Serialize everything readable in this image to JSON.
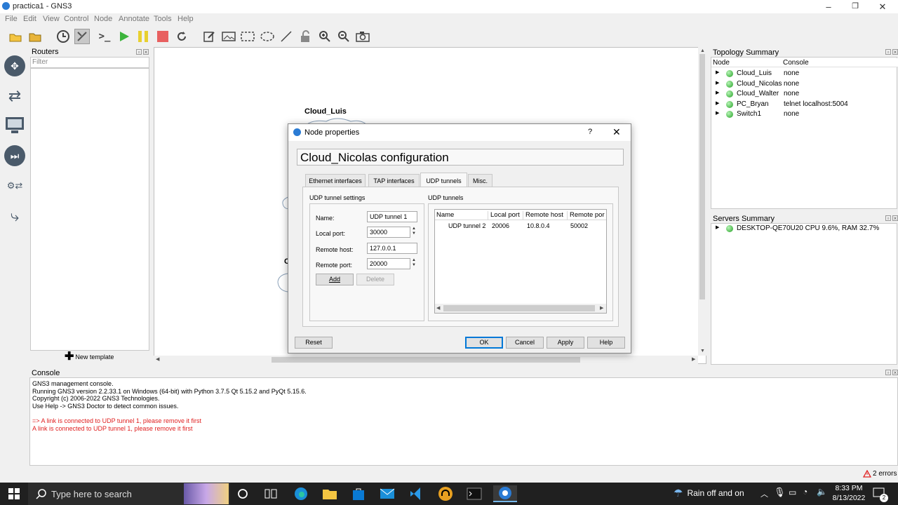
{
  "window": {
    "title": "practica1 - GNS3"
  },
  "menu": [
    "File",
    "Edit",
    "View",
    "Control",
    "Node",
    "Annotate",
    "Tools",
    "Help"
  ],
  "routers_panel": {
    "title": "Routers",
    "filter_placeholder": "Filter",
    "new_template": "New template"
  },
  "canvas": {
    "node_label": "Cloud_Luis",
    "partial_label": "C"
  },
  "topology": {
    "title": "Topology Summary",
    "col_node": "Node",
    "col_console": "Console",
    "rows": [
      {
        "node": "Cloud_Luis",
        "console": "none"
      },
      {
        "node": "Cloud_Nicolas",
        "console": "none"
      },
      {
        "node": "Cloud_Walter",
        "console": "none"
      },
      {
        "node": "PC_Bryan",
        "console": "telnet localhost:5004"
      },
      {
        "node": "Switch1",
        "console": "none"
      }
    ]
  },
  "servers": {
    "title": "Servers Summary",
    "row": "DESKTOP-QE70U20 CPU 9.6%, RAM 32.7%"
  },
  "console": {
    "title": "Console",
    "lines": [
      "GNS3 management console.",
      "Running GNS3 version 2.2.33.1 on Windows (64-bit) with Python 3.7.5 Qt 5.15.2 and PyQt 5.15.6.",
      "Copyright (c) 2006-2022 GNS3 Technologies.",
      "Use Help -> GNS3 Doctor to detect common issues."
    ],
    "errors": [
      "=> A link is connected to UDP tunnel 1, please remove it first",
      "A link is connected to UDP tunnel 1, please remove it first"
    ]
  },
  "status": {
    "errors": "2 errors"
  },
  "dialog": {
    "title": "Node properties",
    "help_char": "?",
    "header": "Cloud_Nicolas configuration",
    "tabs": [
      "Ethernet interfaces",
      "TAP interfaces",
      "UDP tunnels",
      "Misc."
    ],
    "settings_title": "UDP tunnel settings",
    "tunnels_title": "UDP tunnels",
    "name_label": "Name:",
    "name_value": "UDP tunnel 1",
    "local_port_label": "Local port:",
    "local_port_value": "30000",
    "remote_host_label": "Remote host:",
    "remote_host_value": "127.0.0.1",
    "remote_port_label": "Remote port:",
    "remote_port_value": "20000",
    "add": "Add",
    "delete": "Delete",
    "table_headers": [
      "Name",
      "Local port",
      "Remote host",
      "Remote por"
    ],
    "table_row": [
      "UDP tunnel 2",
      "20006",
      "10.8.0.4",
      "50002"
    ],
    "reset": "Reset",
    "ok": "OK",
    "cancel": "Cancel",
    "apply": "Apply",
    "help": "Help"
  },
  "taskbar": {
    "search_placeholder": "Type here to search",
    "weather": "Rain off and on",
    "time": "8:33 PM",
    "date": "8/13/2022",
    "notif_count": "2"
  }
}
